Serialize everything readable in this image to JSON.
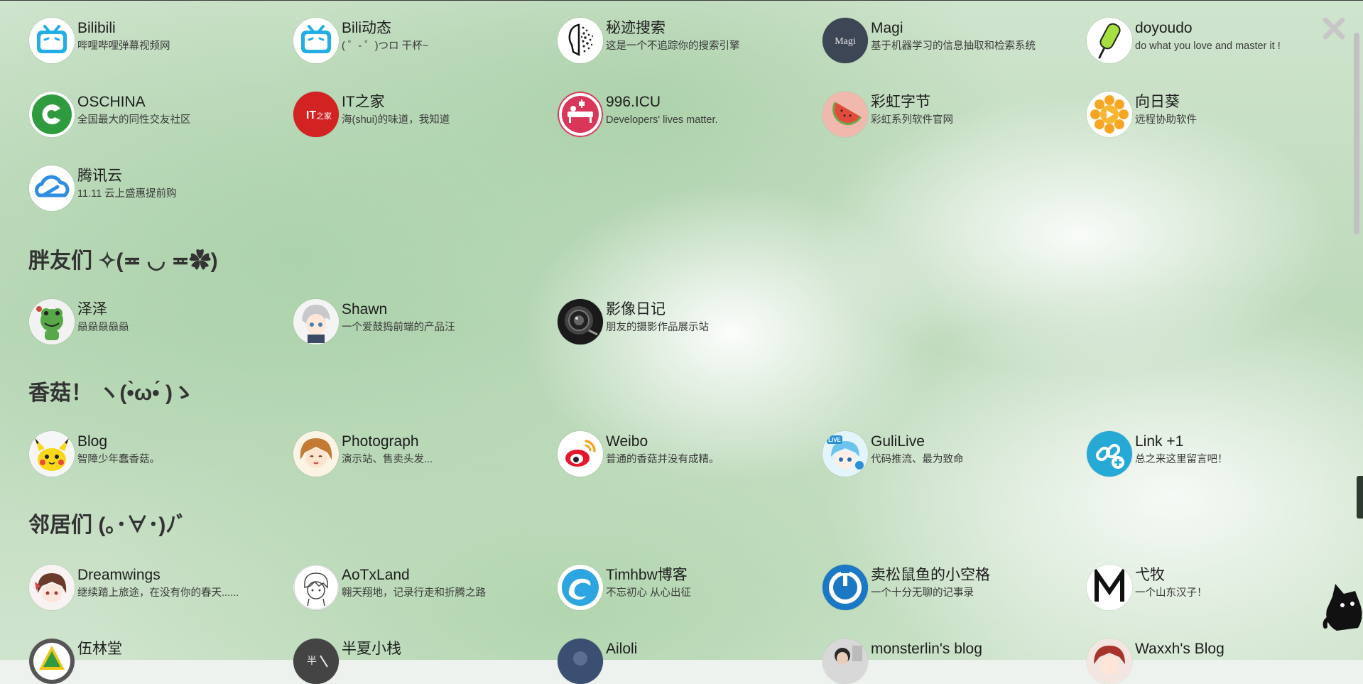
{
  "close_label": "close",
  "sections": {
    "friends": "胖友们 ✧(≖ ◡ ≖✿)",
    "mushroom": "香菇！ ヽ(•̀ω•́ )ゝ",
    "neighbors": "邻居们 (｡･∀･)ﾉﾞ"
  },
  "links": [
    {
      "name": "Bilibili",
      "desc": "哔哩哔哩弹幕视频网"
    },
    {
      "name": "Bili动态",
      "desc": "( ゜- ゜)つロ 干杯~"
    },
    {
      "name": "秘迹搜索",
      "desc": "这是一个不追踪你的搜索引擎"
    },
    {
      "name": "Magi",
      "desc": "基于机器学习的信息抽取和检索系统"
    },
    {
      "name": "doyoudo",
      "desc": "do what you love and master it !"
    },
    {
      "name": "OSCHINA",
      "desc": "全国最大的同性交友社区"
    },
    {
      "name": "IT之家",
      "desc": "海(shui)的味道，我知道"
    },
    {
      "name": "996.ICU",
      "desc": "Developers' lives matter."
    },
    {
      "name": "彩虹字节",
      "desc": "彩虹系列软件官网"
    },
    {
      "name": "向日葵",
      "desc": "远程协助软件"
    },
    {
      "name": "腾讯云",
      "desc": "11.11 云上盛惠提前购"
    }
  ],
  "friends": [
    {
      "name": "泽泽",
      "desc": "赑赑赑赑赑"
    },
    {
      "name": "Shawn",
      "desc": "一个爱鼓捣前端的产品汪"
    },
    {
      "name": "影像日记",
      "desc": "朋友的摄影作品展示站"
    }
  ],
  "mushroom": [
    {
      "name": "Blog",
      "desc": "智障少年蠢香菇。"
    },
    {
      "name": "Photograph",
      "desc": "演示站、售卖头发..."
    },
    {
      "name": "Weibo",
      "desc": "普通的香菇并没有成精。"
    },
    {
      "name": "GuliLive",
      "desc": "代码推流、最为致命"
    },
    {
      "name": "Link +1",
      "desc": "总之来这里留言吧！"
    }
  ],
  "neighbors": [
    {
      "name": "Dreamwings",
      "desc": "继续踏上旅途，在没有你的春天......"
    },
    {
      "name": "AoTxLand",
      "desc": "翱天翔地，记录行走和折腾之路"
    },
    {
      "name": "Timhbw博客",
      "desc": "不忘初心 从心出征"
    },
    {
      "name": "卖松鼠鱼的小空格",
      "desc": "一个十分无聊的记事录"
    },
    {
      "name": "弋牧",
      "desc": "一个山东汉子！"
    },
    {
      "name": "伍林堂",
      "desc": ""
    },
    {
      "name": "半夏小栈",
      "desc": ""
    },
    {
      "name": "Ailoli",
      "desc": ""
    },
    {
      "name": "monsterlin's blog",
      "desc": ""
    },
    {
      "name": "Waxxh's Blog",
      "desc": ""
    }
  ],
  "colors": {
    "bilibili": "#23ade5",
    "oschina": "#2e9c3e",
    "ithome": "#d22222",
    "icu996": "#d9365a",
    "link": "#27a9d6",
    "weibo": "#e6162d",
    "section_text": "#333333"
  }
}
